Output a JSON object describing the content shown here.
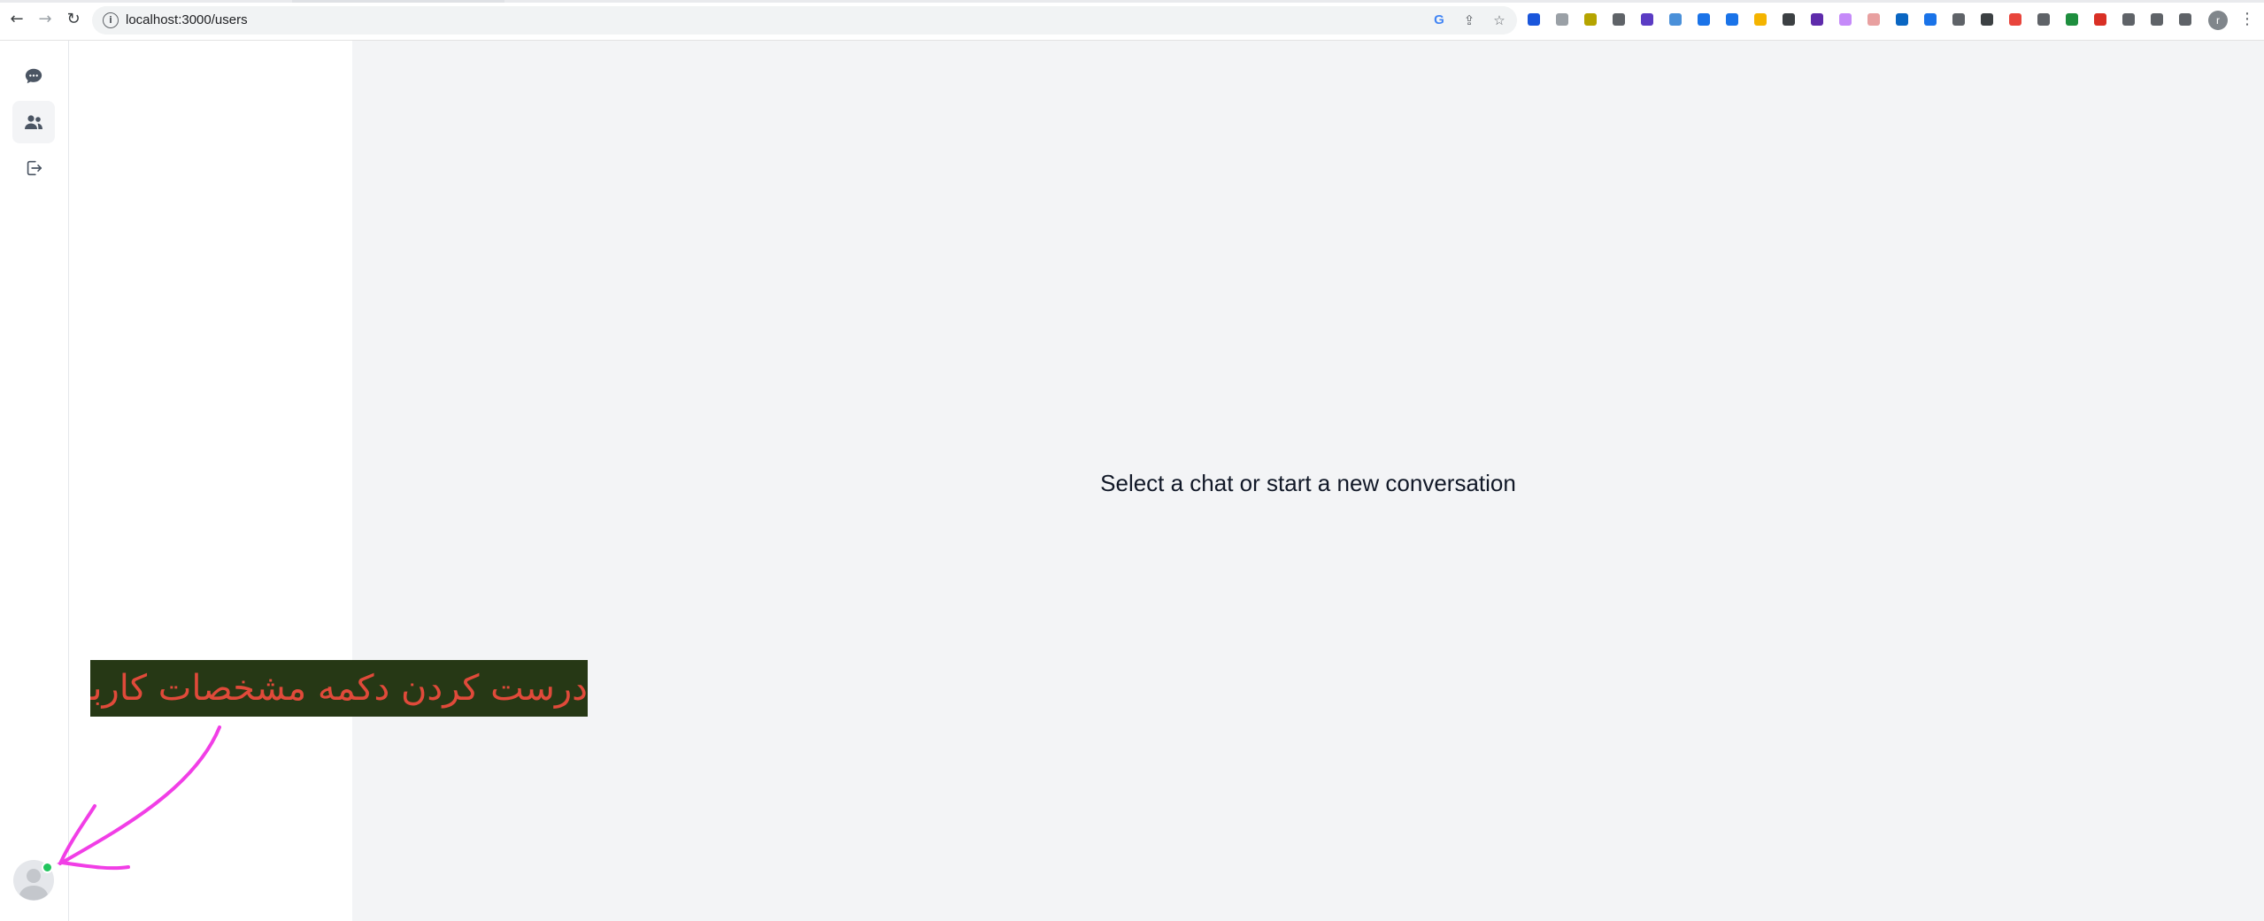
{
  "browser": {
    "url": "localhost:3000/users",
    "profile_initial": "r",
    "nav": {
      "back": "←",
      "forward": "→",
      "reload": "↻"
    },
    "omnibox_icons": [
      "google-lens-icon",
      "share-icon",
      "bookmark-star-icon"
    ],
    "extensions": [
      {
        "name": "ext-blue-square-icon",
        "color": "#1a56db"
      },
      {
        "name": "ext-keyboard-icon",
        "color": "#9aa0a6"
      },
      {
        "name": "ext-yellow-green-icon",
        "color": "#b5a400"
      },
      {
        "name": "ext-qr-icon",
        "color": "#5f6368"
      },
      {
        "name": "ext-purple-diamond-icon",
        "color": "#5b3cc4"
      },
      {
        "name": "ext-globe-icon",
        "color": "#4a90d9"
      },
      {
        "name": "ext-window-icon",
        "color": "#1a73e8"
      },
      {
        "name": "ext-download-arrow-icon",
        "color": "#1a73e8"
      },
      {
        "name": "ext-pen-icon",
        "color": "#f4b400"
      },
      {
        "name": "ext-tools-icon",
        "color": "#3c4043"
      },
      {
        "name": "ext-purple-circle-icon",
        "color": "#5e2bab"
      },
      {
        "name": "ext-feather-icon",
        "color": "#c58af9"
      },
      {
        "name": "ext-calendar-icon",
        "color": "#e8a0a0"
      },
      {
        "name": "ext-linkedin-icon",
        "color": "#0a66c2"
      },
      {
        "name": "ext-capture-icon",
        "color": "#1a73e8"
      },
      {
        "name": "ext-sun-icon",
        "color": "#5f6368"
      },
      {
        "name": "ext-block-icon",
        "color": "#3c4043"
      },
      {
        "name": "ext-adblock-icon",
        "color": "#e8453c"
      },
      {
        "name": "ext-bracket-icon",
        "color": "#5f6368"
      },
      {
        "name": "ext-shield-icon",
        "color": "#1e8e3e"
      },
      {
        "name": "ext-record-icon",
        "color": "#d93025"
      },
      {
        "name": "extensions-puzzle-icon",
        "color": "#5f6368"
      },
      {
        "name": "downloads-icon",
        "color": "#5f6368"
      },
      {
        "name": "side-panel-icon",
        "color": "#5f6368"
      }
    ]
  },
  "sidebar": {
    "items": [
      {
        "name": "chat-icon",
        "active": false
      },
      {
        "name": "users-icon",
        "active": true
      },
      {
        "name": "logout-icon",
        "active": false
      }
    ],
    "user": {
      "online": true,
      "status_color": "#22c55e"
    }
  },
  "main": {
    "empty_message": "Select a chat or start a new conversation",
    "background": "#f3f4f6"
  },
  "annotation": {
    "text": "درست کردن دکمه مشخصات کاربری",
    "box_color": "#263815",
    "text_color": "#e04a3a",
    "arrow_color": "#f13ee6"
  }
}
